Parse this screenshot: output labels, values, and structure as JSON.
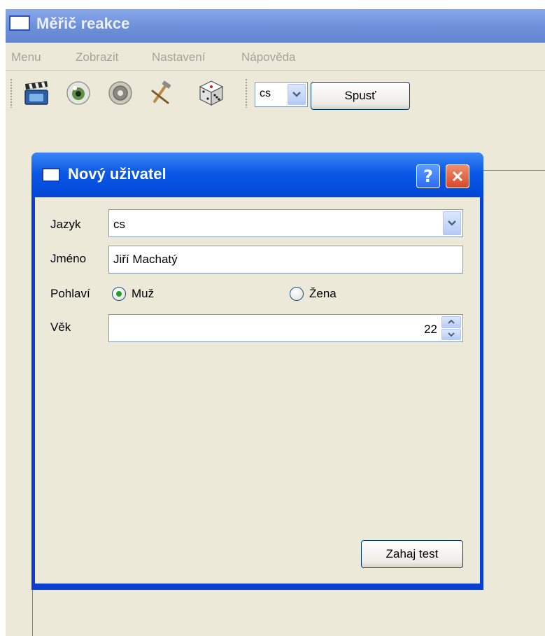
{
  "app": {
    "title": "Měřič reakce"
  },
  "menu": {
    "items": [
      "Menu",
      "Zobrazit",
      "Nastavení",
      "Nápověda"
    ]
  },
  "toolbar": {
    "icons": [
      "clapperboard-icon",
      "eye-icon",
      "speaker-icon",
      "hammer-icon",
      "dice-icon"
    ],
    "language_value": "cs",
    "run_label": "Spusť"
  },
  "dialog": {
    "title": "Nový uživatel",
    "help_glyph": "?",
    "language_label": "Jazyk",
    "language_value": "cs",
    "name_label": "Jméno",
    "name_value": "Jiří Machatý",
    "gender_label": "Pohlaví",
    "gender_options": [
      "Muž",
      "Žena"
    ],
    "gender_selected": "Muž",
    "age_label": "Věk",
    "age_value": "22",
    "start_label": "Zahaj test"
  },
  "colors": {
    "titlebar_inactive": "#7a9ae0",
    "dialog_titlebar": "#0a58e6",
    "face": "#ece9d8",
    "radio_selected": "#21a121",
    "close_button": "#d9472a"
  }
}
